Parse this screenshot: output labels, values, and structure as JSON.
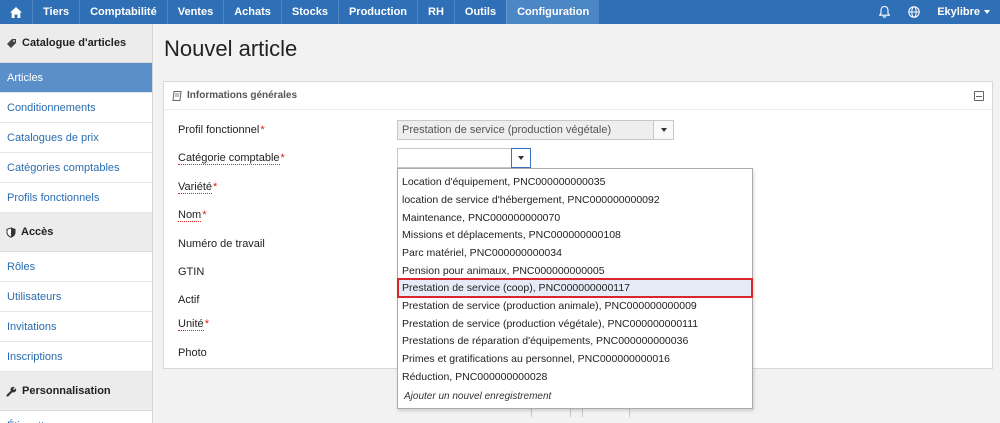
{
  "topnav": {
    "items": [
      "Tiers",
      "Comptabilité",
      "Ventes",
      "Achats",
      "Stocks",
      "Production",
      "RH",
      "Outils",
      "Configuration"
    ],
    "active": "Configuration",
    "user": "Ekylibre"
  },
  "sidebar": {
    "sections": [
      {
        "title": "Catalogue d'articles",
        "icon": "tag-icon",
        "items": [
          "Articles",
          "Conditionnements",
          "Catalogues de prix",
          "Catégories comptables",
          "Profils fonctionnels"
        ]
      },
      {
        "title": "Accès",
        "icon": "shield-icon",
        "items": [
          "Rôles",
          "Utilisateurs",
          "Invitations",
          "Inscriptions"
        ]
      },
      {
        "title": "Personnalisation",
        "icon": "wrench-icon",
        "items": [
          "Étiquettes"
        ]
      }
    ],
    "active_item": "Articles"
  },
  "page": {
    "title": "Nouvel article"
  },
  "panel": {
    "title": "Informations générales"
  },
  "form": {
    "fields": [
      {
        "label": "Profil fonctionnel",
        "required": true
      },
      {
        "label": "Catégorie comptable",
        "required": true
      },
      {
        "label": "Variété",
        "required": true
      },
      {
        "label": "Nom",
        "required": true
      },
      {
        "label": "Numéro de travail",
        "required": false
      },
      {
        "label": "GTIN",
        "required": false
      },
      {
        "label": "Actif",
        "required": false
      },
      {
        "label": "Unité",
        "required": true
      },
      {
        "label": "Photo",
        "required": false
      }
    ],
    "profil_value": "Prestation de service (production végétale)",
    "categorie_value": ""
  },
  "dropdown": {
    "options": [
      "Location d'équipement, PNC000000000035",
      "location de service d'hébergement, PNC000000000092",
      "Maintenance, PNC000000000070",
      "Missions et déplacements, PNC000000000108",
      "Parc matériel, PNC000000000034",
      "Pension pour animaux, PNC000000000005",
      "Prestation de service (coop), PNC000000000117",
      "Prestation de service (production animale), PNC000000000009",
      "Prestation de service (production végétale), PNC000000000111",
      "Prestations de réparation d'équipements, PNC000000000036",
      "Primes et gratifications au personnel, PNC000000000016",
      "Réduction, PNC000000000028"
    ],
    "highlighted": "Prestation de service (coop), PNC000000000117",
    "add_new": "Ajouter un nouvel enregistrement"
  }
}
